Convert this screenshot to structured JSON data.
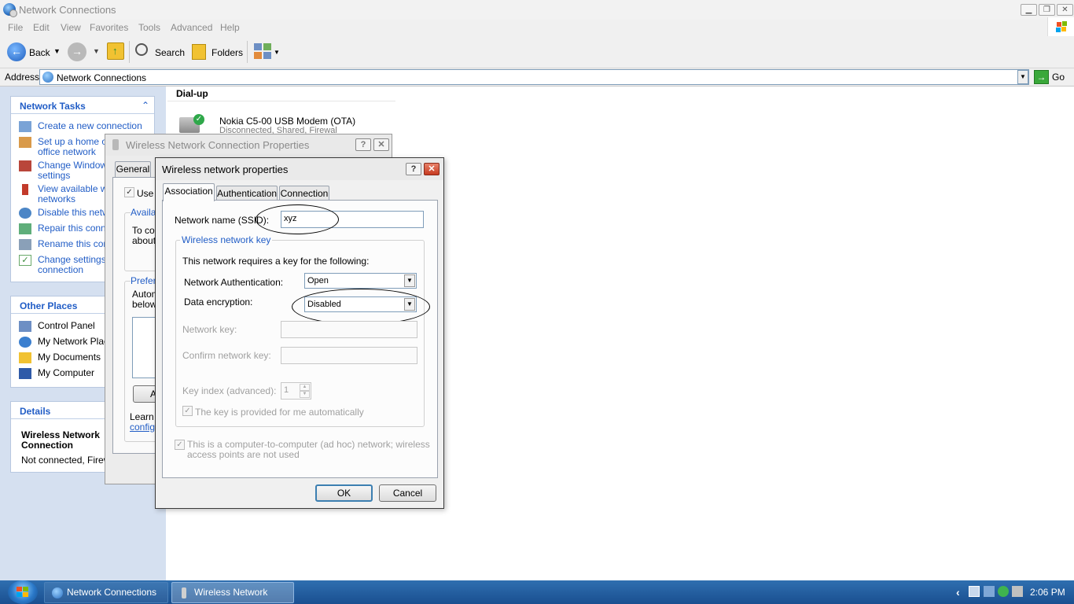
{
  "window": {
    "title": "Network Connections"
  },
  "menu": [
    "File",
    "Edit",
    "View",
    "Favorites",
    "Tools",
    "Advanced",
    "Help"
  ],
  "toolbar": {
    "back": "Back",
    "search": "Search",
    "folders": "Folders"
  },
  "address": {
    "label": "Address",
    "value": "Network Connections",
    "go": "Go"
  },
  "network_tasks": {
    "title": "Network Tasks",
    "items": [
      {
        "lines": [
          "Create a new connection"
        ]
      },
      {
        "lines": [
          "Set up a home or",
          "office network"
        ]
      },
      {
        "lines": [
          "Change Windows",
          "settings"
        ]
      },
      {
        "lines": [
          "View available wir",
          "networks"
        ]
      },
      {
        "lines": [
          "Disable this netwo"
        ]
      },
      {
        "lines": [
          "Repair this conne"
        ]
      },
      {
        "lines": [
          "Rename this conn"
        ]
      },
      {
        "lines": [
          "Change settings o",
          "connection"
        ]
      }
    ]
  },
  "other_places": {
    "title": "Other Places",
    "items": [
      "Control Panel",
      "My Network Place",
      "My Documents",
      "My Computer"
    ]
  },
  "details": {
    "title": "Details",
    "name_lines": [
      "Wireless Network",
      "Connection"
    ],
    "status": "Not connected, Firewa"
  },
  "content": {
    "section": "Dial-up",
    "device_name": "Nokia C5-00 USB Modem (OTA)",
    "device_status": "Disconnected, Shared, Firewal"
  },
  "back_dialog": {
    "title": "Wireless Network Connection Properties",
    "tab_general": "General",
    "use_windows": "Use V",
    "available": "Availa",
    "to_connect": [
      "To co",
      "about"
    ],
    "preferred": "Prefer",
    "auto_lines": [
      "Autom",
      "below"
    ],
    "add_btn": "A",
    "learn_lines": [
      "Learn a",
      "configu"
    ]
  },
  "dialog": {
    "title": "Wireless network properties",
    "tabs": [
      "Association",
      "Authentication",
      "Connection"
    ],
    "ssid_label": "Network name (SSID):",
    "ssid_value": "xyz",
    "key_group": "Wireless network key",
    "key_intro": "This network requires a key for the following:",
    "auth_label": "Network Authentication:",
    "auth_value": "Open",
    "enc_label": "Data encryption:",
    "enc_value": "Disabled",
    "netkey_label": "Network key:",
    "confirm_label": "Confirm network key:",
    "keyindex_label": "Key index (advanced):",
    "keyindex_value": "1",
    "auto_key": "The key is provided for me automatically",
    "adhoc_lines": [
      "This is a computer-to-computer (ad hoc) network; wireless",
      "access points are not used"
    ],
    "ok": "OK",
    "cancel": "Cancel",
    "help_glyph": "?",
    "close_glyph": "✕"
  },
  "taskbar": {
    "items": [
      "Network Connections",
      "Wireless Network Con..."
    ],
    "clock": "2:06 PM",
    "tray_chevron": "‹"
  },
  "icons": [
    "network-icon",
    "back-arrow-icon",
    "forward-arrow-icon",
    "up-folder-icon",
    "search-icon",
    "folders-icon",
    "views-icon",
    "go-arrow-icon",
    "windows-flag-icon",
    "chevron-up-icon",
    "modem-icon",
    "wireless-icon"
  ],
  "colors": {
    "task_link": "#215dc6",
    "pane_bg": "#d5e0f0",
    "taskbar": "#1a4f90",
    "close_red": "#c63a20"
  }
}
